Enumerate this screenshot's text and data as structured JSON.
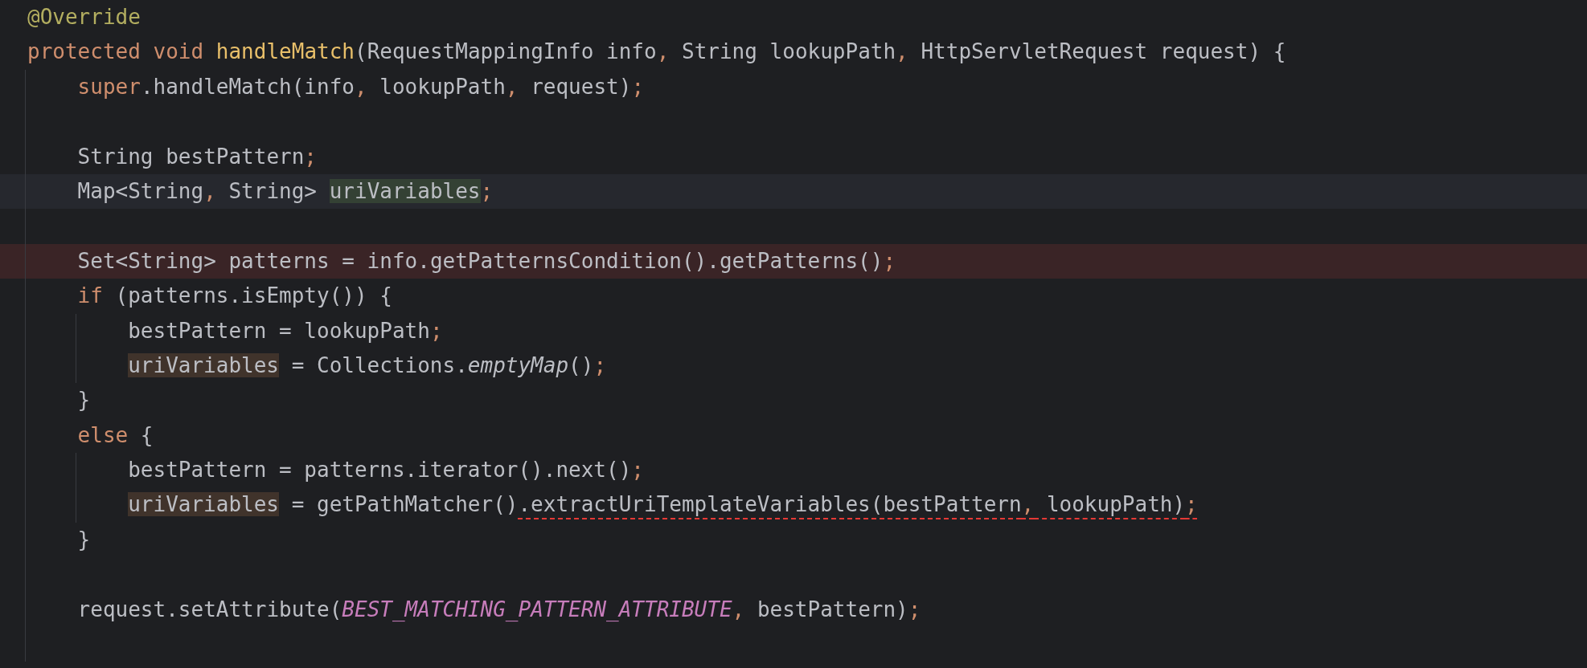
{
  "editor": {
    "lines": [
      {
        "kind": "code",
        "tokens": [
          {
            "t": "@Override",
            "kind": "annotation"
          }
        ]
      },
      {
        "kind": "code",
        "tokens": [
          {
            "t": "protected void ",
            "kind": "keyword"
          },
          {
            "t": "handleMatch",
            "kind": "function"
          },
          {
            "t": "(RequestMappingInfo info",
            "kind": "plain"
          },
          {
            "t": ",",
            "kind": "punct"
          },
          {
            "t": " String lookupPath",
            "kind": "plain"
          },
          {
            "t": ",",
            "kind": "punct"
          },
          {
            "t": " HttpServletRequest request) {",
            "kind": "plain"
          }
        ],
        "children": [
          {
            "kind": "code",
            "tokens": [
              {
                "t": "super",
                "kind": "keyword"
              },
              {
                "t": ".handleMatch(info",
                "kind": "plain"
              },
              {
                "t": ",",
                "kind": "punct"
              },
              {
                "t": " lookupPath",
                "kind": "plain"
              },
              {
                "t": ",",
                "kind": "punct"
              },
              {
                "t": " request)",
                "kind": "plain"
              },
              {
                "t": ";",
                "kind": "punct"
              }
            ]
          },
          {
            "kind": "blank"
          },
          {
            "kind": "code",
            "tokens": [
              {
                "t": "String bestPattern",
                "kind": "plain"
              },
              {
                "t": ";",
                "kind": "punct"
              }
            ]
          },
          {
            "kind": "current",
            "tokens": [
              {
                "t": "Map<String",
                "kind": "plain"
              },
              {
                "t": ",",
                "kind": "punct"
              },
              {
                "t": " String> ",
                "kind": "plain"
              },
              {
                "t": "uriVariables",
                "kind": "varwrite"
              },
              {
                "t": ";",
                "kind": "punct"
              }
            ]
          },
          {
            "kind": "blank"
          },
          {
            "kind": "error",
            "tokens": [
              {
                "t": "Set<String> patterns = info.getPatternsCondition().getPatterns()",
                "kind": "plain"
              },
              {
                "t": ";",
                "kind": "punct"
              }
            ]
          },
          {
            "kind": "code",
            "tokens": [
              {
                "t": "if",
                "kind": "keyword"
              },
              {
                "t": " (patterns.isEmpty()) {",
                "kind": "plain"
              }
            ],
            "children": [
              {
                "kind": "code",
                "tokens": [
                  {
                    "t": "bestPattern = lookupPath",
                    "kind": "plain"
                  },
                  {
                    "t": ";",
                    "kind": "punct"
                  }
                ]
              },
              {
                "kind": "code",
                "tokens": [
                  {
                    "t": "uriVariables",
                    "kind": "varread"
                  },
                  {
                    "t": " = Collections.",
                    "kind": "plain"
                  },
                  {
                    "t": "emptyMap",
                    "kind": "static"
                  },
                  {
                    "t": "()",
                    "kind": "plain"
                  },
                  {
                    "t": ";",
                    "kind": "punct"
                  }
                ]
              }
            ]
          },
          {
            "kind": "code",
            "tokens": [
              {
                "t": "}",
                "kind": "plain"
              }
            ]
          },
          {
            "kind": "code",
            "tokens": [
              {
                "t": "else",
                "kind": "keyword"
              },
              {
                "t": " {",
                "kind": "plain"
              }
            ],
            "children": [
              {
                "kind": "code",
                "tokens": [
                  {
                    "t": "bestPattern = patterns.iterator().next()",
                    "kind": "plain"
                  },
                  {
                    "t": ";",
                    "kind": "punct"
                  }
                ]
              },
              {
                "kind": "code",
                "tokens": [
                  {
                    "t": "uriVariables",
                    "kind": "varread"
                  },
                  {
                    "t": " = getPathMatcher()",
                    "kind": "plain"
                  },
                  {
                    "t": ".extractUriTemplateVariables(bestPattern",
                    "kind": "plain",
                    "error": true
                  },
                  {
                    "t": ",",
                    "kind": "punct",
                    "error": true
                  },
                  {
                    "t": " lookupPath)",
                    "kind": "plain",
                    "error": true
                  },
                  {
                    "t": ";",
                    "kind": "punct",
                    "error": true
                  }
                ]
              }
            ]
          },
          {
            "kind": "code",
            "tokens": [
              {
                "t": "}",
                "kind": "plain"
              }
            ]
          },
          {
            "kind": "blank"
          },
          {
            "kind": "code",
            "tokens": [
              {
                "t": "request.setAttribute(",
                "kind": "plain"
              },
              {
                "t": "BEST_MATCHING_PATTERN_ATTRIBUTE",
                "kind": "constant"
              },
              {
                "t": ",",
                "kind": "punct"
              },
              {
                "t": " bestPattern)",
                "kind": "plain"
              },
              {
                "t": ";",
                "kind": "punct"
              }
            ]
          },
          {
            "kind": "blank"
          }
        ]
      }
    ]
  }
}
